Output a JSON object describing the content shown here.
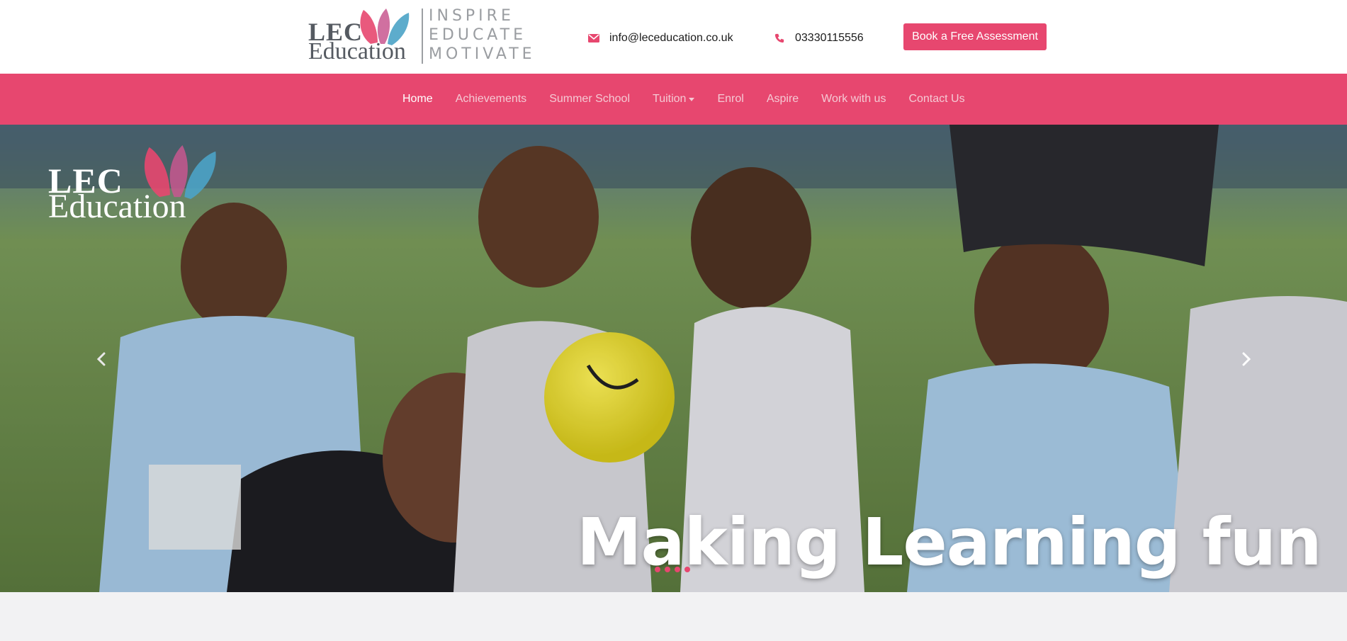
{
  "header": {
    "logo": {
      "brand_line1": "LEC",
      "brand_line2": "Education",
      "tagline": [
        "INSPIRE",
        "EDUCATE",
        "MOTIVATE"
      ]
    },
    "email": {
      "icon": "envelope-icon",
      "text": "info@leceducation.co.uk"
    },
    "phone": {
      "icon": "phone-icon",
      "text": "03330115556"
    },
    "cta_label": "Book a Free Assessment"
  },
  "nav": {
    "items": [
      {
        "label": "Home",
        "active": true
      },
      {
        "label": "Achievements"
      },
      {
        "label": "Summer School"
      },
      {
        "label": "Tuition",
        "dropdown": true
      },
      {
        "label": "Enrol"
      },
      {
        "label": "Aspire"
      },
      {
        "label": "Work with us"
      },
      {
        "label": "Contact Us"
      }
    ]
  },
  "hero": {
    "logo_line1": "LEC",
    "logo_line2": "Education",
    "caption": "Making Learning fun",
    "prev_icon": "chevron-left-icon",
    "next_icon": "chevron-right-icon",
    "slide_count": 4
  },
  "colors": {
    "brand_pink": "#e7476f",
    "brand_blue": "#4ba3c7",
    "logo_grey": "#555a61"
  }
}
